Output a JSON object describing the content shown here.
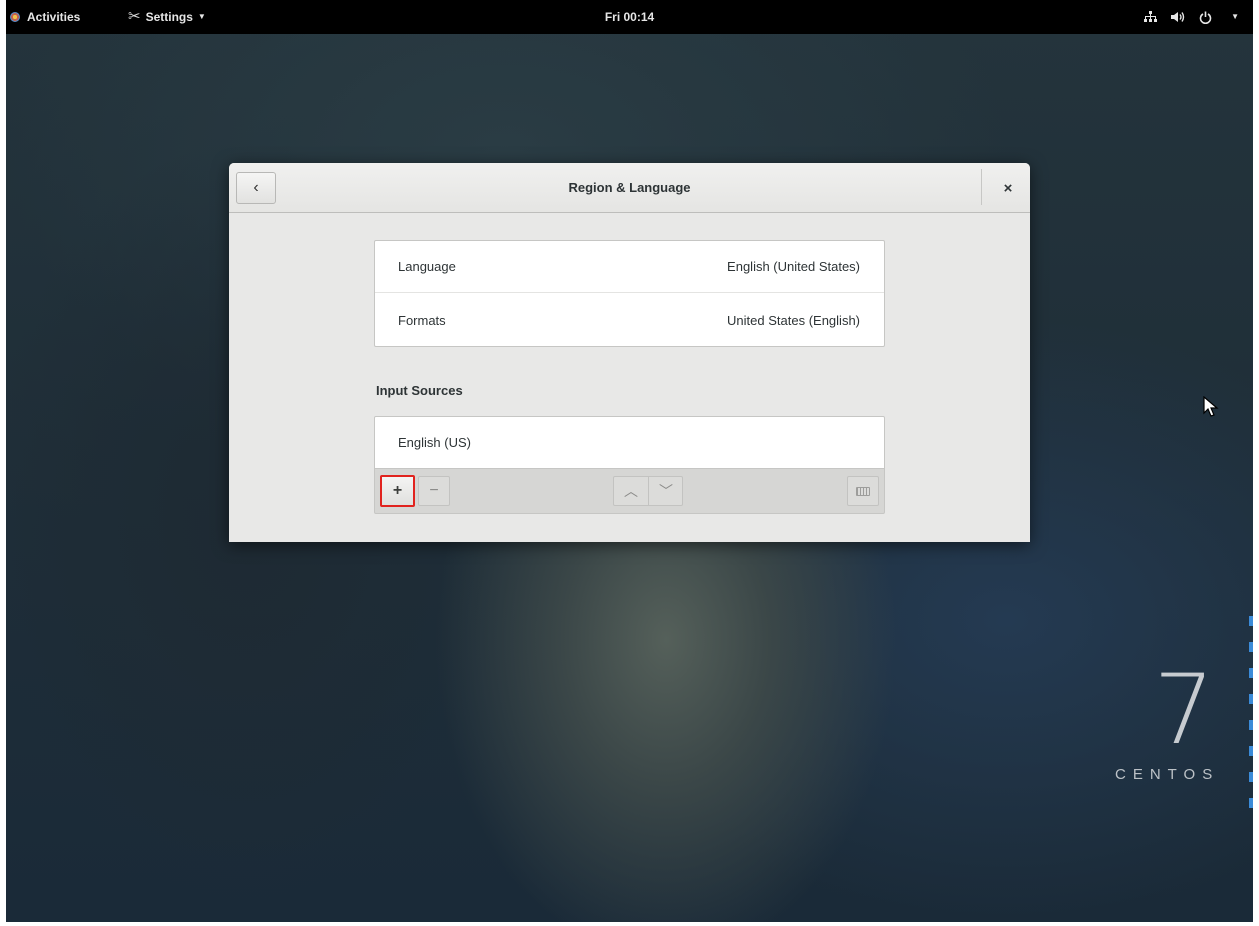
{
  "topbar": {
    "activities_label": "Activities",
    "app_menu_label": "Settings",
    "clock": "Fri 00:14",
    "status_icons": [
      "network-icon",
      "volume-icon",
      "power-icon"
    ]
  },
  "dialog": {
    "title": "Region & Language",
    "back_glyph": "‹",
    "close_glyph": "×",
    "locale_rows": [
      {
        "label": "Language",
        "value": "English (United States)"
      },
      {
        "label": "Formats",
        "value": "United States (English)"
      }
    ],
    "input_sources_heading": "Input Sources",
    "input_sources": [
      "English (US)"
    ],
    "toolbar": {
      "add_glyph": "+",
      "remove_glyph": "−",
      "up_glyph": "︿",
      "down_glyph": "﹀"
    }
  },
  "desktop": {
    "brand_number": "7",
    "brand_name": "CENTOS"
  },
  "colors": {
    "highlight": "#e1231e",
    "topbar": "#000000"
  }
}
